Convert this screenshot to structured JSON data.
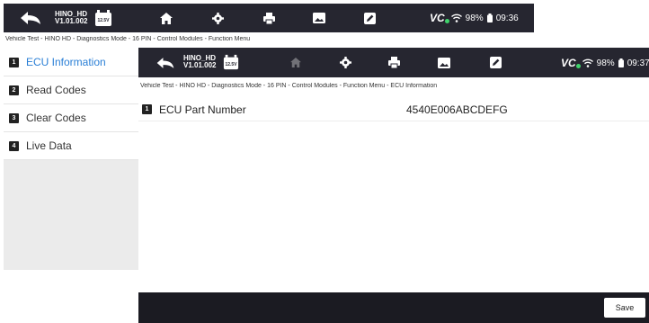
{
  "back_window": {
    "app_title": "HINO_HD",
    "app_version": "V1.01.002",
    "badge": "12.5V",
    "vci_label": "VC",
    "battery": "98%",
    "time": "09:36",
    "breadcrumb": "Vehicle Test - HINO HD - Diagnostics Mode - 16 PIN - Control Modules - Function Menu"
  },
  "sidebar": {
    "items": [
      {
        "num": "1",
        "label": "ECU Information"
      },
      {
        "num": "2",
        "label": "Read Codes"
      },
      {
        "num": "3",
        "label": "Clear Codes"
      },
      {
        "num": "4",
        "label": "Live Data"
      }
    ]
  },
  "front_window": {
    "app_title": "HINO_HD",
    "app_version": "V1.01.002",
    "badge": "12.5V",
    "vci_label": "VC",
    "battery": "98%",
    "time": "09:37",
    "breadcrumb": "Vehicle Test - HINO HD - Diagnostics Mode - 16 PIN - Control Modules - Function Menu - ECU Information",
    "rows": [
      {
        "num": "1",
        "label": "ECU Part Number",
        "value": "4540E006ABCDEFG"
      }
    ],
    "save_label": "Save"
  },
  "icons": [
    "back-arrow-icon",
    "home-icon",
    "gear-icon",
    "print-icon",
    "image-icon",
    "edit-icon",
    "wifi-icon",
    "battery-icon",
    "vehicle-battery-icon"
  ],
  "colors": {
    "topbar": "#262630",
    "active": "#2a7fd6",
    "bottombar": "#1b1b22"
  }
}
